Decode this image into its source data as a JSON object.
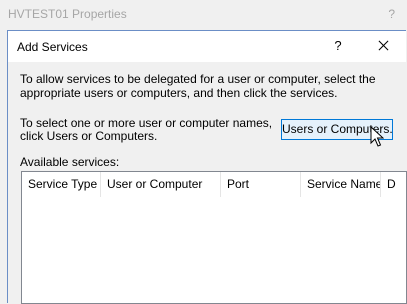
{
  "background_window": {
    "title": "HVTEST01 Properties",
    "help": "?"
  },
  "dialog": {
    "title": "Add Services",
    "help": "?",
    "intro": "To allow services to be delegated for a user or computer, select the appropriate users or computers, and then click the services.",
    "select_text": "To select one or more user or computer names, click Users or Computers.",
    "users_button": "Users or Computers...",
    "available_label": "Available services:",
    "columns": [
      "Service Type",
      "User or Computer",
      "Port",
      "Service Name",
      "D"
    ]
  },
  "icons": {
    "close": "close-icon",
    "cursor": "mouse-pointer-icon"
  },
  "colors": {
    "accent_border": "#0078d7",
    "button_fill": "#e5f1fb",
    "dialog_border": "#6b8ec6"
  }
}
